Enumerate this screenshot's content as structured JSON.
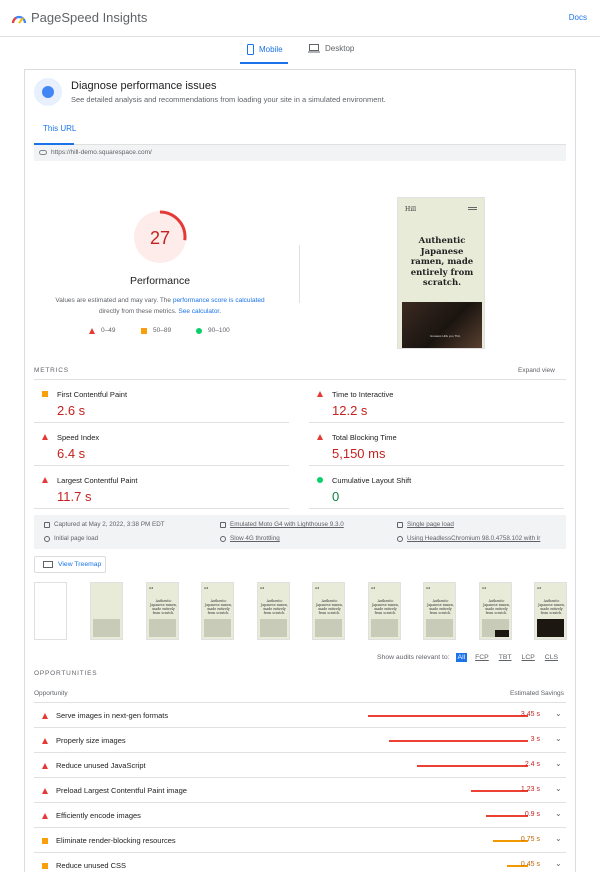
{
  "header": {
    "brand": "PageSpeed Insights",
    "docs": "Docs"
  },
  "device_tabs": {
    "mobile": "Mobile",
    "desktop": "Desktop"
  },
  "diagnose": {
    "title": "Diagnose performance issues",
    "subtitle": "See detailed analysis and recommendations from loading your site in a simulated environment."
  },
  "url_tab": "This URL",
  "url": "https://hill-demo.squarespace.com/",
  "score": {
    "value": "27",
    "fraction": 0.27,
    "label": "Performance",
    "note_pre": "Values are estimated and may vary. The ",
    "note_link": "performance score is calculated",
    "note_mid": " directly from these metrics. ",
    "note_link2": "See calculator",
    "note_end": ".",
    "legend": [
      "0–49",
      "50–89",
      "90–100"
    ],
    "colors": {
      "fail": "#e53935",
      "average": "#fa9f0c",
      "pass": "#0cce6b"
    }
  },
  "screenshot": {
    "brand": "Hill",
    "headline": "Authentic Japanese ramen, made entirely from scratch.",
    "caption": "Greatest Hills you Thin"
  },
  "metrics": {
    "label": "METRICS",
    "expand": "Expand view",
    "items": [
      {
        "title": "First Contentful Paint",
        "value": "2.6 s",
        "rating": "average"
      },
      {
        "title": "Time to Interactive",
        "value": "12.2 s",
        "rating": "fail"
      },
      {
        "title": "Speed Index",
        "value": "6.4 s",
        "rating": "fail"
      },
      {
        "title": "Total Blocking Time",
        "value": "5,150 ms",
        "rating": "fail"
      },
      {
        "title": "Largest Contentful Paint",
        "value": "11.7 s",
        "rating": "fail"
      },
      {
        "title": "Cumulative Layout Shift",
        "value": "0",
        "rating": "pass"
      }
    ]
  },
  "environment": {
    "captured": "Captured at May 2, 2022, 3:38 PM EDT",
    "device": "Emulated Moto G4 with Lighthouse 9.3.0",
    "load": "Single page load",
    "initial": "Initial page load",
    "throttling": "Slow 4G throttling",
    "browser": "Using HeadlessChromium 98.0.4758.102 with lr"
  },
  "treemap": "View Treemap",
  "filter": {
    "label": "Show audits relevant to:",
    "chips": [
      "All",
      "FCP",
      "TBT",
      "LCP",
      "CLS"
    ]
  },
  "opportunities": {
    "label": "OPPORTUNITIES",
    "col_left": "Opportunity",
    "col_right": "Estimated Savings",
    "items": [
      {
        "title": "Serve images in next-gen formats",
        "savings": "3.45 s",
        "amount": 3.45,
        "rating": "fail"
      },
      {
        "title": "Properly size images",
        "savings": "3 s",
        "amount": 3.0,
        "rating": "fail"
      },
      {
        "title": "Reduce unused JavaScript",
        "savings": "2.4 s",
        "amount": 2.4,
        "rating": "fail"
      },
      {
        "title": "Preload Largest Contentful Paint image",
        "savings": "1.23 s",
        "amount": 1.23,
        "rating": "fail"
      },
      {
        "title": "Efficiently encode images",
        "savings": "0.9 s",
        "amount": 0.9,
        "rating": "fail"
      },
      {
        "title": "Eliminate render-blocking resources",
        "savings": "0.75 s",
        "amount": 0.75,
        "rating": "average"
      },
      {
        "title": "Reduce unused CSS",
        "savings": "0.45 s",
        "amount": 0.45,
        "rating": "average"
      }
    ]
  }
}
